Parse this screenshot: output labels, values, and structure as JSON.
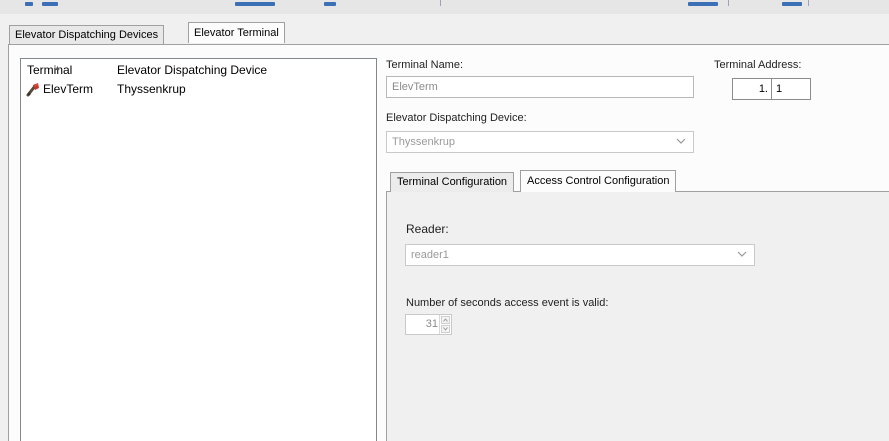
{
  "colors": {
    "title_strip_accent": "#3b6fb6",
    "window_bg": "#f0f0f0",
    "disabled_text": "#8b8b8b"
  },
  "main_tabs": [
    {
      "label": "Elevator Dispatching Devices",
      "selected": false
    },
    {
      "label": "Elevator Terminal",
      "selected": true
    }
  ],
  "terminal_list": {
    "columns": [
      "Terminal",
      "Elevator Dispatching Device"
    ],
    "rows": [
      {
        "icon": "elevator-terminal-icon",
        "terminal": "ElevTerm",
        "device": "Thyssenkrup"
      }
    ]
  },
  "form": {
    "terminal_name_label": "Terminal Name:",
    "terminal_name_value": "ElevTerm",
    "terminal_address_label": "Terminal Address:",
    "terminal_address_part1": "1.",
    "terminal_address_part2": "1",
    "device_label": "Elevator Dispatching Device:",
    "device_value": "Thyssenkrup"
  },
  "config_tabs": [
    {
      "label": "Terminal Configuration",
      "selected": false
    },
    {
      "label": "Access Control Configuration",
      "selected": true
    }
  ],
  "access_control": {
    "reader_label": "Reader:",
    "reader_value": "reader1",
    "seconds_label": "Number of seconds access event is valid:",
    "seconds_value": "31"
  }
}
